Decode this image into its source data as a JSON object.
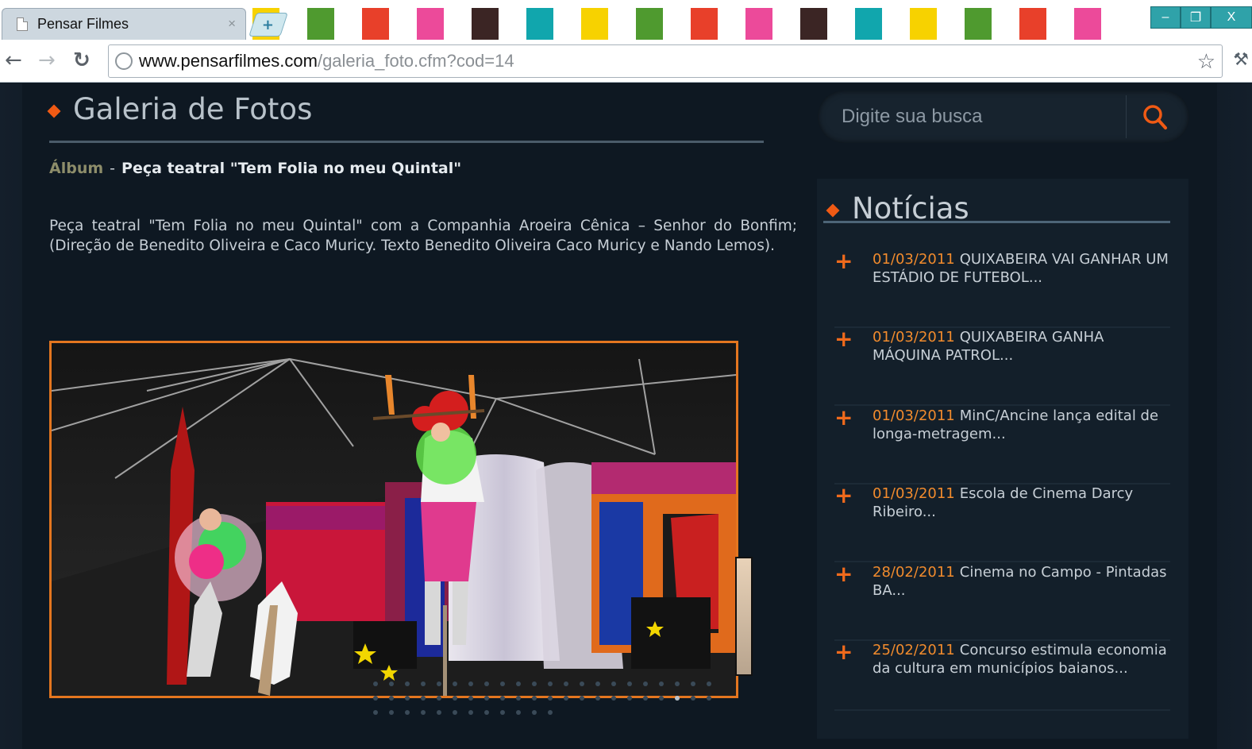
{
  "browser": {
    "tab_title": "Pensar Filmes",
    "tab_close": "×",
    "new_tab": "+",
    "url_host": "www.pensarfilmes.com",
    "url_path": "/galeria_foto.cfm?cod=14",
    "stripe_colors": [
      "#f7d200",
      "#ffffff",
      "#4f9a2f",
      "#ffffff",
      "#e8402a",
      "#ffffff",
      "#ec4a9a",
      "#ffffff",
      "#3b2524",
      "#ffffff",
      "#11a6ad",
      "#ffffff",
      "#f7d200",
      "#ffffff",
      "#4f9a2f",
      "#ffffff",
      "#e8402a",
      "#ffffff",
      "#ec4a9a",
      "#ffffff",
      "#3b2524",
      "#ffffff",
      "#11a6ad",
      "#ffffff",
      "#f7d200",
      "#ffffff",
      "#4f9a2f",
      "#ffffff",
      "#e8402a",
      "#ffffff",
      "#ec4a9a",
      "#ffffff"
    ],
    "icons": [
      "back-icon",
      "forward-icon",
      "reload-icon",
      "globe-icon",
      "star-icon",
      "wrench-icon"
    ],
    "window_controls": {
      "minimize": "–",
      "restore": "❐",
      "close": "X"
    }
  },
  "gallery": {
    "title": "Galeria de Fotos",
    "album_label": "Álbum",
    "album_separator": "-",
    "album_name": "Peça teatral \"Tem Folia no meu Quintal\"",
    "description": "Peça teatral \"Tem Folia no meu Quintal\" com a Companhia Aroeira Cênica – Senhor do Bonfim; (Direção de Benedito Oliveira e Caco Muricy. Texto Benedito Oliveira Caco Muricy e Nando Lemos).",
    "photo_alt": "Clowns performing on stilts under a circus tent",
    "dots": {
      "count": 56,
      "active_index": 41
    }
  },
  "search": {
    "placeholder": "Digite sua busca",
    "icon": "search-icon"
  },
  "news": {
    "title": "Notícias",
    "accent_color": "#f06a1c",
    "items": [
      {
        "date": "01/03/2011",
        "text": "QUIXABEIRA VAI GANHAR UM ESTÁDIO DE FUTEBOL..."
      },
      {
        "date": "01/03/2011",
        "text": "QUIXABEIRA GANHA MÁQUINA PATROL..."
      },
      {
        "date": "01/03/2011",
        "text": "MinC/Ancine lança edital de longa-metragem..."
      },
      {
        "date": "01/03/2011",
        "text": "Escola de Cinema Darcy Ribeiro..."
      },
      {
        "date": "28/02/2011",
        "text": "Cinema no Campo - Pintadas BA..."
      },
      {
        "date": "25/02/2011",
        "text": "Concurso estimula economia da cultura em municípios baianos..."
      }
    ]
  }
}
